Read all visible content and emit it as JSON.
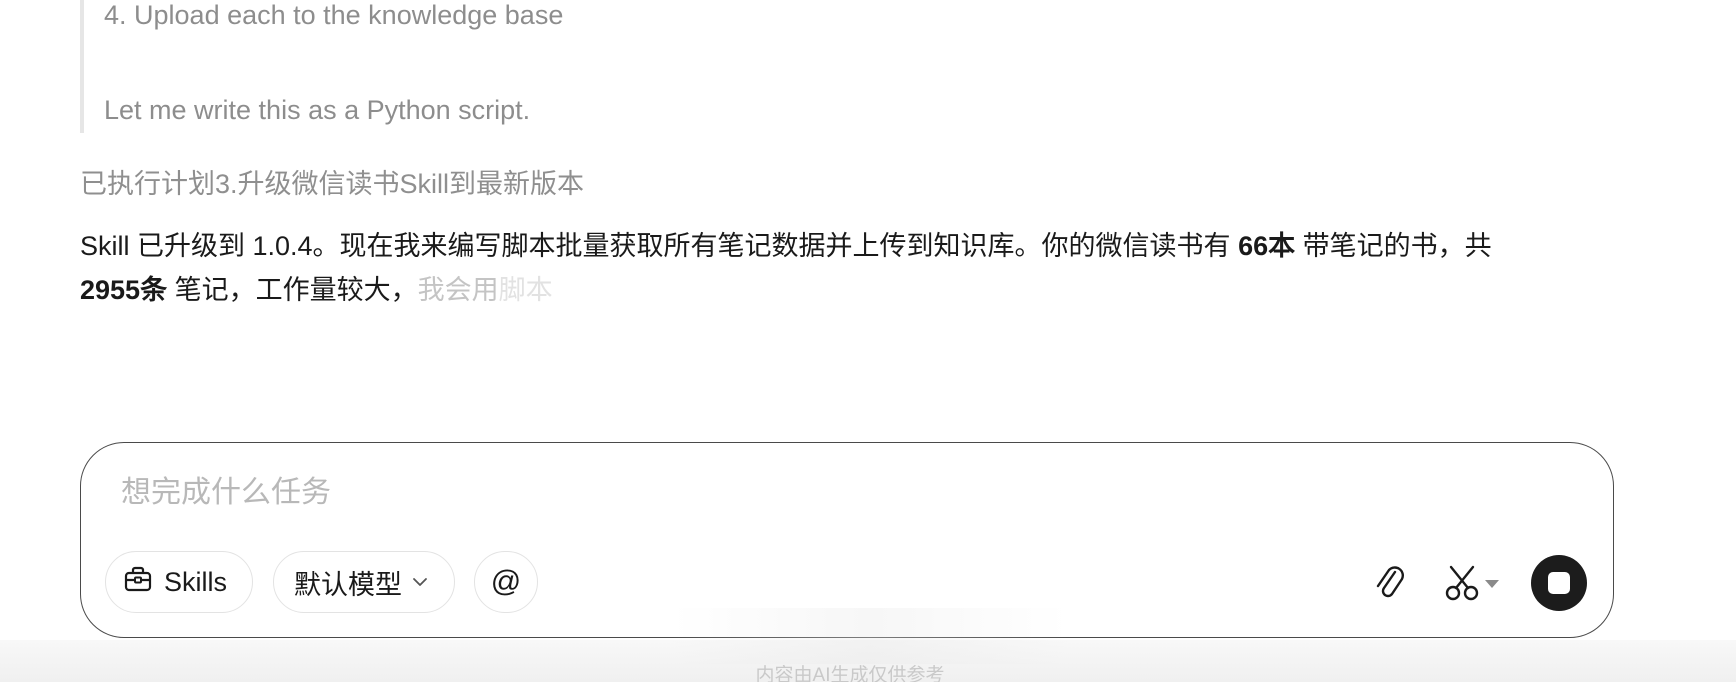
{
  "thinking": {
    "line_step4": "4. Upload each to the knowledge base",
    "line_plan": "Let me write this as a Python script."
  },
  "step_status": "已执行计划3.升级微信读书Skill到最新版本",
  "answer": {
    "part1": "Skill 已升级到 1.0.4。现在我来编写脚本批量获取所有笔记数据并上传到知识库。你的微信读书有 ",
    "book_count": "66本",
    "part2": " 带笔记的书，共",
    "note_count": "2955条",
    "part3": " 笔记，工作量较大，",
    "streaming_a": "我会用",
    "streaming_b": "脚本"
  },
  "composer": {
    "placeholder": "想完成什么任务",
    "skills_label": "Skills",
    "model_label": "默认模型",
    "mention_label": "@"
  },
  "icons": {
    "skills": "toolbox-icon",
    "model_dropdown": "chevron-down-icon",
    "attach": "paperclip-icon",
    "scissors": "scissors-icon",
    "stop": "stop-icon"
  },
  "disclaimer": "内容由AI生成仅供参考"
}
